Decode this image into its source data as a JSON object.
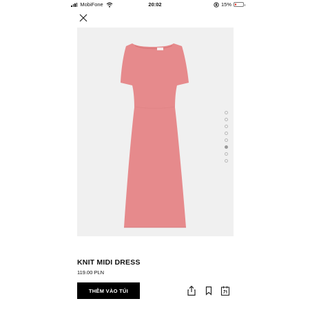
{
  "status_bar": {
    "carrier": "MobiFone",
    "time": "20:02",
    "battery": "15%",
    "battery_level": 0.15,
    "icons": [
      "signal-icon",
      "wifi-icon",
      "orientation-lock-icon",
      "battery-icon"
    ]
  },
  "toolbar": {
    "close_icon": "close-icon"
  },
  "gallery": {
    "image_count": 8,
    "active_index": 5,
    "background_color": "#f0f0f0",
    "dress_color": "#e68a8c"
  },
  "product": {
    "name": "KNIT MIDI DRESS",
    "price": "119.00 PLN"
  },
  "actions": {
    "add_to_cart_label": "THÊM VÀO TÚI",
    "icons": [
      "share-icon",
      "bookmark-icon",
      "size-guide-icon"
    ]
  },
  "colors": {
    "accent": "#000000",
    "battery_low": "#e63b2e"
  }
}
